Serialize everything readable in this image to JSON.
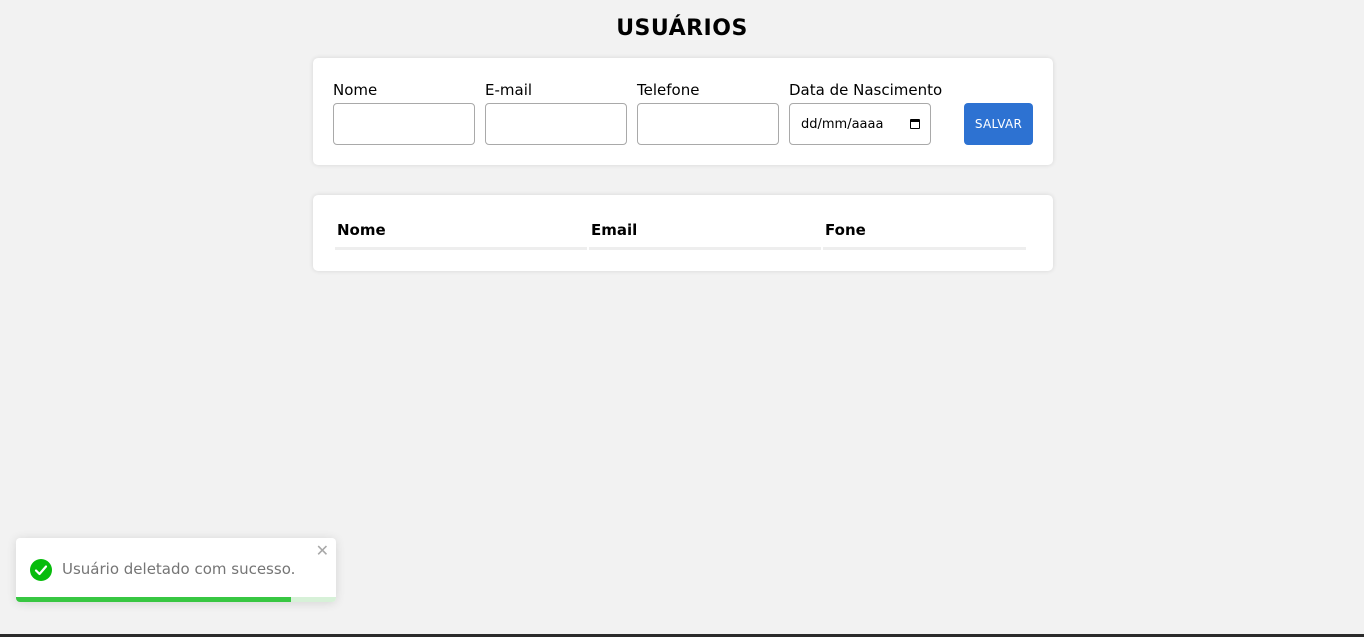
{
  "page": {
    "title": "USUÁRIOS"
  },
  "form": {
    "fields": [
      {
        "label": "Nome",
        "value": ""
      },
      {
        "label": "E-mail",
        "value": ""
      },
      {
        "label": "Telefone",
        "value": ""
      },
      {
        "label": "Data de Nascimento",
        "value": "dd/mm/aaaa"
      }
    ],
    "save_label": "SALVAR",
    "date_icon": "calendar-icon"
  },
  "table": {
    "headers": [
      "Nome",
      "Email",
      "Fone"
    ],
    "rows": []
  },
  "toast": {
    "message": "Usuário deletado com sucesso.",
    "icon": "check-circle-icon",
    "close": "✕",
    "progress": 0.86
  },
  "colors": {
    "background": "#f2f2f2",
    "accent": "#2d72d2",
    "success": "#07bc0c",
    "progress": "#38c742"
  }
}
